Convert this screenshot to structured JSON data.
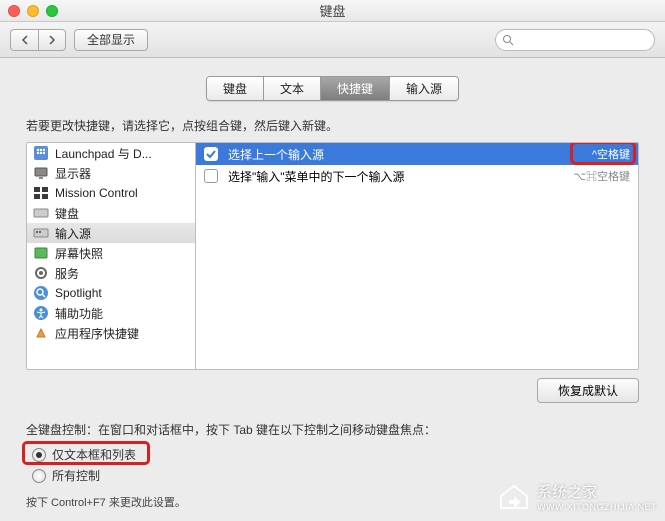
{
  "window": {
    "title": "键盘"
  },
  "toolbar": {
    "show_all": "全部显示",
    "search_placeholder": ""
  },
  "tabs": [
    {
      "label": "键盘"
    },
    {
      "label": "文本"
    },
    {
      "label": "快捷键"
    },
    {
      "label": "输入源"
    }
  ],
  "active_tab": 2,
  "hint": "若要更改快捷键，请选择它，点按组合键，然后键入新键。",
  "categories": [
    {
      "label": "Launchpad 与 D...",
      "icon": "launchpad"
    },
    {
      "label": "显示器",
      "icon": "display"
    },
    {
      "label": "Mission Control",
      "icon": "mission"
    },
    {
      "label": "键盘",
      "icon": "keyboard"
    },
    {
      "label": "输入源",
      "icon": "input",
      "selected": true
    },
    {
      "label": "屏幕快照",
      "icon": "screenshot"
    },
    {
      "label": "服务",
      "icon": "services"
    },
    {
      "label": "Spotlight",
      "icon": "spotlight"
    },
    {
      "label": "辅助功能",
      "icon": "accessibility"
    },
    {
      "label": "应用程序快捷键",
      "icon": "apps"
    }
  ],
  "shortcuts": [
    {
      "checked": true,
      "label": "选择上一个输入源",
      "key": "^空格键",
      "selected": true
    },
    {
      "checked": false,
      "label": "选择\"输入\"菜单中的下一个输入源",
      "key": "⌥⌘空格键"
    }
  ],
  "restore": "恢复成默认",
  "kb_control": {
    "desc": "全键盘控制：在窗口和对话框中，按下 Tab 键在以下控制之间移动键盘焦点：",
    "opt1": "仅文本框和列表",
    "opt2": "所有控制",
    "footnote": "按下 Control+F7 来更改此设置。"
  },
  "watermark": {
    "name": "系统之家",
    "url": "WWW.XITONGZHIJIA.NET"
  }
}
